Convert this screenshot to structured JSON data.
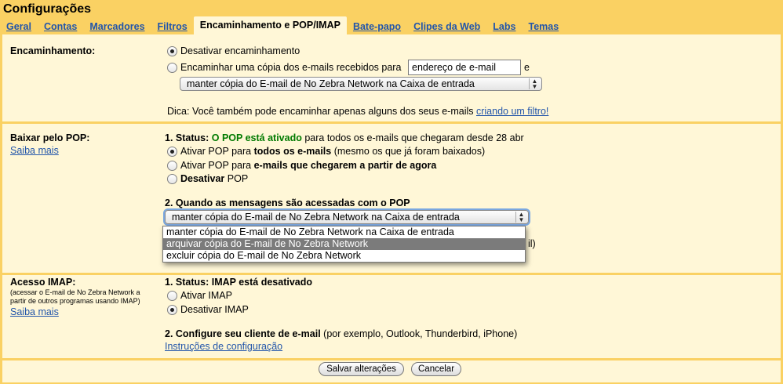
{
  "page_title": "Configurações",
  "tabs": [
    {
      "label": "Geral"
    },
    {
      "label": "Contas"
    },
    {
      "label": "Marcadores"
    },
    {
      "label": "Filtros"
    },
    {
      "label": "Encaminhamento e POP/IMAP"
    },
    {
      "label": "Bate-papo"
    },
    {
      "label": "Clipes da Web"
    },
    {
      "label": "Labs"
    },
    {
      "label": "Temas"
    }
  ],
  "active_tab": "Encaminhamento e POP/IMAP",
  "forwarding": {
    "label": "Encaminhamento:",
    "opt_disable": "Desativar encaminhamento",
    "opt_forward": "Encaminhar uma cópia dos e-mails recebidos para",
    "email_value": "endereço de e-mail",
    "and": "e",
    "select_value": "manter cópia do E-mail de No Zebra Network na Caixa de entrada",
    "tip_text": "Dica: Você também pode encaminhar apenas alguns dos seus e-mails",
    "tip_link": "criando um filtro!"
  },
  "pop": {
    "label": "Baixar pelo POP:",
    "learn_more": "Saiba mais",
    "status_prefix": "1. Status:",
    "status_value": "O POP está ativado",
    "status_suffix": "para todos os e-mails que chegaram desde 28 abr",
    "opt1_a": "Ativar POP para",
    "opt1_b": "todos os e-mails",
    "opt1_c": "(mesmo os que já foram baixados)",
    "opt2_a": "Ativar POP para",
    "opt2_b": "e-mails que chegarem a partir de agora",
    "opt3_a": "Desativar",
    "opt3_b": "POP",
    "when_heading": "2. Quando as mensagens são acessadas com o POP",
    "select_value": "manter cópia do E-mail de No Zebra Network na Caixa de entrada",
    "dropdown_options": [
      "manter cópia do E-mail de No Zebra Network na Caixa de entrada",
      "arquivar cópia do E-mail de No Zebra Network",
      "excluir cópia do E-mail de No Zebra Network"
    ],
    "hidden_tail": "il)"
  },
  "imap": {
    "label": "Acesso IMAP:",
    "note": "(acessar o E-mail de No Zebra Network a partir de outros programas usando IMAP)",
    "learn_more": "Saiba mais",
    "status": "1. Status: IMAP está desativado",
    "opt_enable": "Ativar IMAP",
    "opt_disable": "Desativar IMAP",
    "configure_bold": "2. Configure seu cliente de e-mail",
    "configure_rest": "(por exemplo, Outlook, Thunderbird, iPhone)",
    "instructions_link": "Instruções de configuração"
  },
  "buttons": {
    "save": "Salvar alterações",
    "cancel": "Cancelar"
  }
}
